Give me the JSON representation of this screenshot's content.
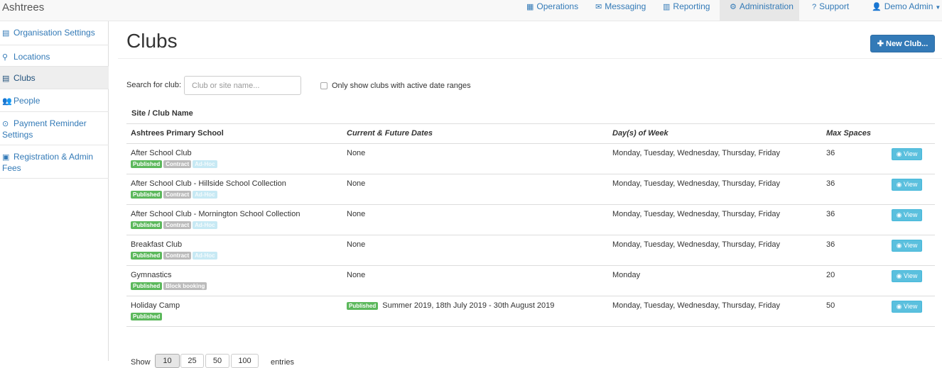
{
  "header": {
    "brand": "Ashtrees",
    "nav": [
      {
        "label": "Operations",
        "icon": "grid-icon"
      },
      {
        "label": "Messaging",
        "icon": "envelope-icon"
      },
      {
        "label": "Reporting",
        "icon": "bar-chart-icon"
      },
      {
        "label": "Administration",
        "icon": "gear-icon",
        "active": true
      },
      {
        "label": "Support",
        "icon": "question-circle-icon"
      },
      {
        "label": "Demo Admin",
        "icon": "user-icon",
        "dropdown": true
      }
    ]
  },
  "sidebar": {
    "items": [
      {
        "label": "Organisation Settings",
        "icon": "building-icon"
      },
      {
        "label": "Locations",
        "icon": "map-marker-icon"
      },
      {
        "label": "Clubs",
        "icon": "building-icon",
        "active": true
      },
      {
        "label": "People",
        "icon": "users-icon"
      },
      {
        "label": "Payment Reminder Settings",
        "icon": "clock-icon"
      },
      {
        "label": "Registration & Admin Fees",
        "icon": "money-icon"
      }
    ]
  },
  "main": {
    "title": "Clubs",
    "new_button": "New Club...",
    "search": {
      "label": "Search for club:",
      "placeholder": "Club or site name...",
      "value": ""
    },
    "filter_checkbox": {
      "label": "Only show clubs with active date ranges",
      "checked": false
    },
    "site_header": "Site / Club Name",
    "columns": [
      "Ashtrees Primary School",
      "Current & Future Dates",
      "Day(s) of Week",
      "Max Spaces"
    ],
    "rows": [
      {
        "name": "After School Club",
        "labels": [
          "Published",
          "Contract",
          "Ad-Hoc"
        ],
        "date_badge": "",
        "dates": "None",
        "days": "Monday, Tuesday, Wednesday, Thursday, Friday",
        "max": "36",
        "action": "View"
      },
      {
        "name": "After School Club - Hillside School Collection",
        "labels": [
          "Published",
          "Contract",
          "Ad-Hoc"
        ],
        "date_badge": "",
        "dates": "None",
        "days": "Monday, Tuesday, Wednesday, Thursday, Friday",
        "max": "36",
        "action": "View"
      },
      {
        "name": "After School Club - Mornington School Collection",
        "labels": [
          "Published",
          "Contract",
          "Ad-Hoc"
        ],
        "date_badge": "",
        "dates": "None",
        "days": "Monday, Tuesday, Wednesday, Thursday, Friday",
        "max": "36",
        "action": "View"
      },
      {
        "name": "Breakfast Club",
        "labels": [
          "Published",
          "Contract",
          "Ad-Hoc"
        ],
        "date_badge": "",
        "dates": "None",
        "days": "Monday, Tuesday, Wednesday, Thursday, Friday",
        "max": "36",
        "action": "View"
      },
      {
        "name": "Gymnastics",
        "labels": [
          "Published",
          "Block booking"
        ],
        "date_badge": "",
        "dates": "None",
        "days": "Monday",
        "max": "20",
        "action": "View"
      },
      {
        "name": "Holiday Camp",
        "labels": [
          "Published"
        ],
        "date_badge": "Published",
        "dates": "Summer 2019, 18th July 2019 - 30th August 2019",
        "days": "Monday, Tuesday, Wednesday, Thursday, Friday",
        "max": "50",
        "action": "View"
      }
    ],
    "pager": {
      "label": "Show",
      "sizes": [
        "10",
        "25",
        "50",
        "100"
      ],
      "active": "10",
      "suffix": "entries"
    }
  },
  "colors": {
    "primary": "#337ab7",
    "published": "#5cb85c",
    "contract": "#bbbbbb",
    "adhoc": "#c7e9f4",
    "info": "#5bc0de"
  }
}
